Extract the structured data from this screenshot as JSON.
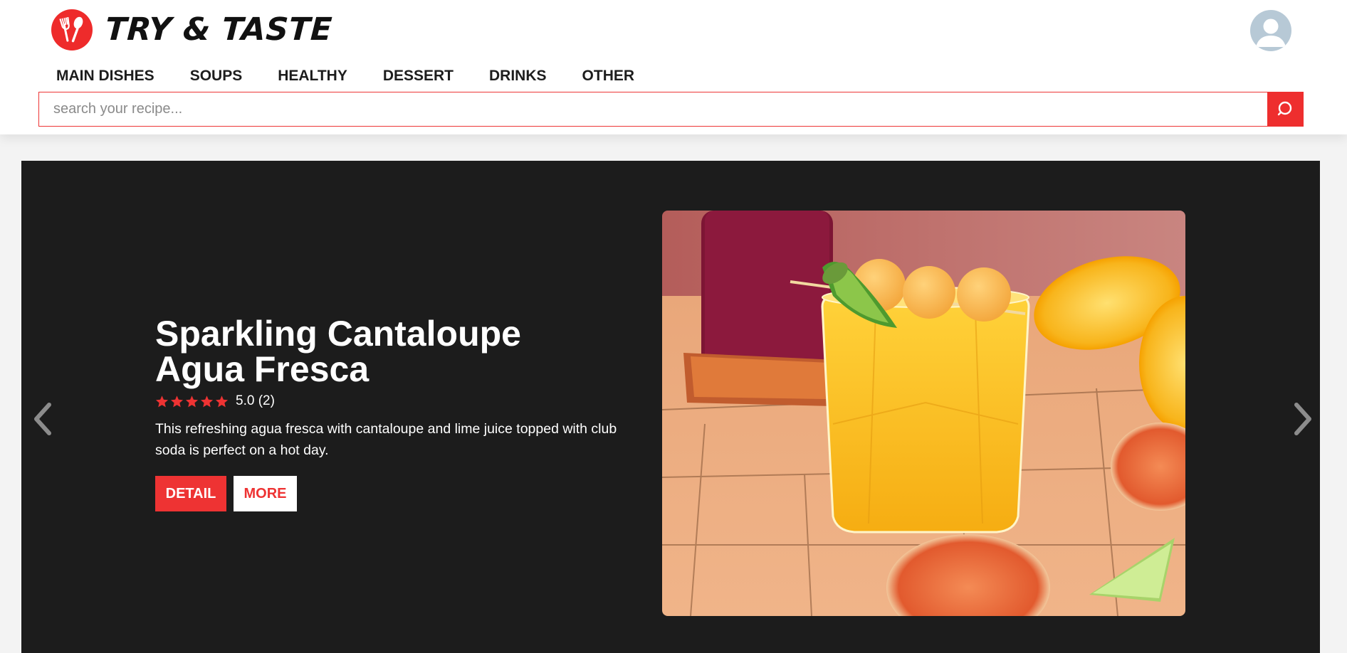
{
  "brand": {
    "name": "TRY & TASTE",
    "logo_icon": "fork-spoon-icon",
    "accent_color": "#ee2b2b"
  },
  "user": {
    "avatar_icon": "user-avatar-icon"
  },
  "nav": {
    "items": [
      {
        "label": "MAIN DISHES"
      },
      {
        "label": "SOUPS"
      },
      {
        "label": "HEALTHY"
      },
      {
        "label": "DESSERT"
      },
      {
        "label": "DRINKS"
      },
      {
        "label": "OTHER"
      }
    ]
  },
  "search": {
    "placeholder": "search your recipe...",
    "value": "",
    "button_icon": "search-icon"
  },
  "hero": {
    "title": "Sparkling Cantaloupe Agua Fresca",
    "rating": {
      "stars": 5,
      "max_stars": 5,
      "text": "5.0 (2)"
    },
    "description": "This refreshing agua fresca with cantaloupe and lime juice topped with club soda is perfect on a hot day.",
    "buttons": {
      "detail": "DETAIL",
      "more": "MORE"
    },
    "prev_icon": "chevron-left-icon",
    "next_icon": "chevron-right-icon",
    "background_color": "#1c1c1c"
  }
}
